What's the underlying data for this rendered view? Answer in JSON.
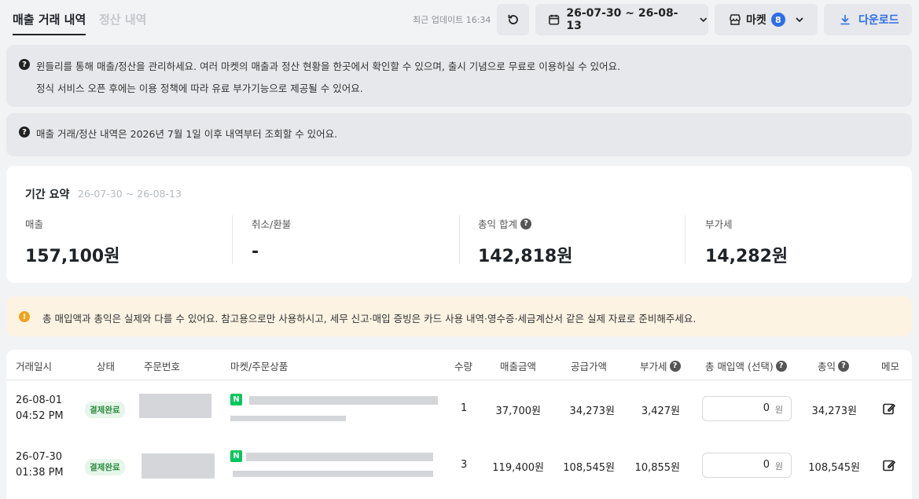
{
  "tabs": [
    {
      "label": "매출 거래 내역",
      "active": true
    },
    {
      "label": "정산 내역",
      "active": false
    }
  ],
  "header": {
    "updated_text": "최근 업데이트 16:34",
    "date_range": "26-07-30 ~ 26-08-13",
    "market_label": "마켓",
    "market_count": "8",
    "download_label": "다운로드",
    "accent_color": "#2e6ee6"
  },
  "info_box_1": {
    "line1": "윈들리를 통해 매출/정산을 관리하세요. 여러 마켓의 매출과 정산 현황을 한곳에서 확인할 수 있으며, 출시 기념으로 무료로 이용하실 수 있어요.",
    "line2": "정식 서비스 오픈 후에는 이용 정책에 따라 유료 부가기능으로 제공될 수 있어요."
  },
  "info_box_2": {
    "line1": "매출 거래/정산 내역은 2026년 7월 1일 이후 내역부터 조회할 수 있어요."
  },
  "summary": {
    "title": "기간 요약",
    "range": "26-07-30 ~ 26-08-13",
    "stats": [
      {
        "label": "매출",
        "value": "157,100원"
      },
      {
        "label": "취소/환불",
        "value": "-"
      },
      {
        "label": "총익 합계",
        "value": "142,818원"
      },
      {
        "label": "부가세",
        "value": "14,282원"
      }
    ]
  },
  "warning": {
    "text": "총 매입액과 총익은 실제와 다를 수 있어요. 참고용으로만 사용하시고, 세무 신고·매입 증빙은 카드 사용 내역·영수증·세금계산서 같은 실제 자료로 준비해주세요."
  },
  "table": {
    "headers": [
      "거래일시",
      "상태",
      "주문번호",
      "마켓/주문상품",
      "수량",
      "매출금액",
      "공급가액",
      "부가세",
      "총 매입액 (선택)",
      "총익",
      "메모"
    ],
    "rows": [
      {
        "date": "26-08-01",
        "time": "04:52 PM",
        "status": "결제완료",
        "market": "N",
        "qty": "1",
        "sales": "37,700원",
        "supply": "34,273원",
        "vat": "3,427원",
        "purchase": "0",
        "purchase_unit": "원",
        "profit": "34,273원"
      },
      {
        "date": "26-07-30",
        "time": "01:38 PM",
        "status": "결제완료",
        "market": "N",
        "qty": "3",
        "sales": "119,400원",
        "supply": "108,545원",
        "vat": "10,855원",
        "purchase": "0",
        "purchase_unit": "원",
        "profit": "108,545원"
      }
    ]
  }
}
